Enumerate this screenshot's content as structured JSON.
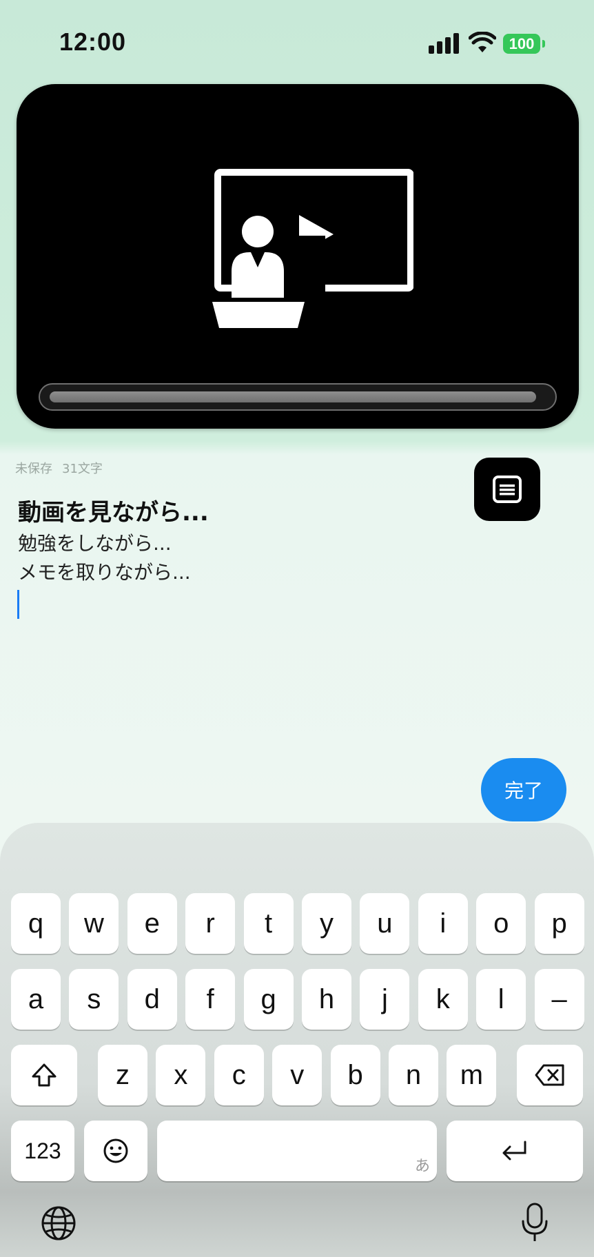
{
  "status_bar": {
    "time": "12:00",
    "battery": "100"
  },
  "video": {
    "progress_fraction": 0.98
  },
  "editor": {
    "save_state": "未保存",
    "char_count": "31文字",
    "lines": [
      "動画を見ながら...",
      "勉強をしながら...",
      "メモを取りながら..."
    ]
  },
  "done_button": "完了",
  "keyboard": {
    "row1": [
      "q",
      "w",
      "e",
      "r",
      "t",
      "y",
      "u",
      "i",
      "o",
      "p"
    ],
    "row2": [
      "a",
      "s",
      "d",
      "f",
      "g",
      "h",
      "j",
      "k",
      "l",
      "–"
    ],
    "row3": [
      "z",
      "x",
      "c",
      "v",
      "b",
      "n",
      "m"
    ],
    "numbers_key": "123",
    "space_hint": "あ"
  },
  "colors": {
    "accent": "#1a8cf0",
    "battery": "#35c759",
    "cursor": "#1a7cf5"
  }
}
